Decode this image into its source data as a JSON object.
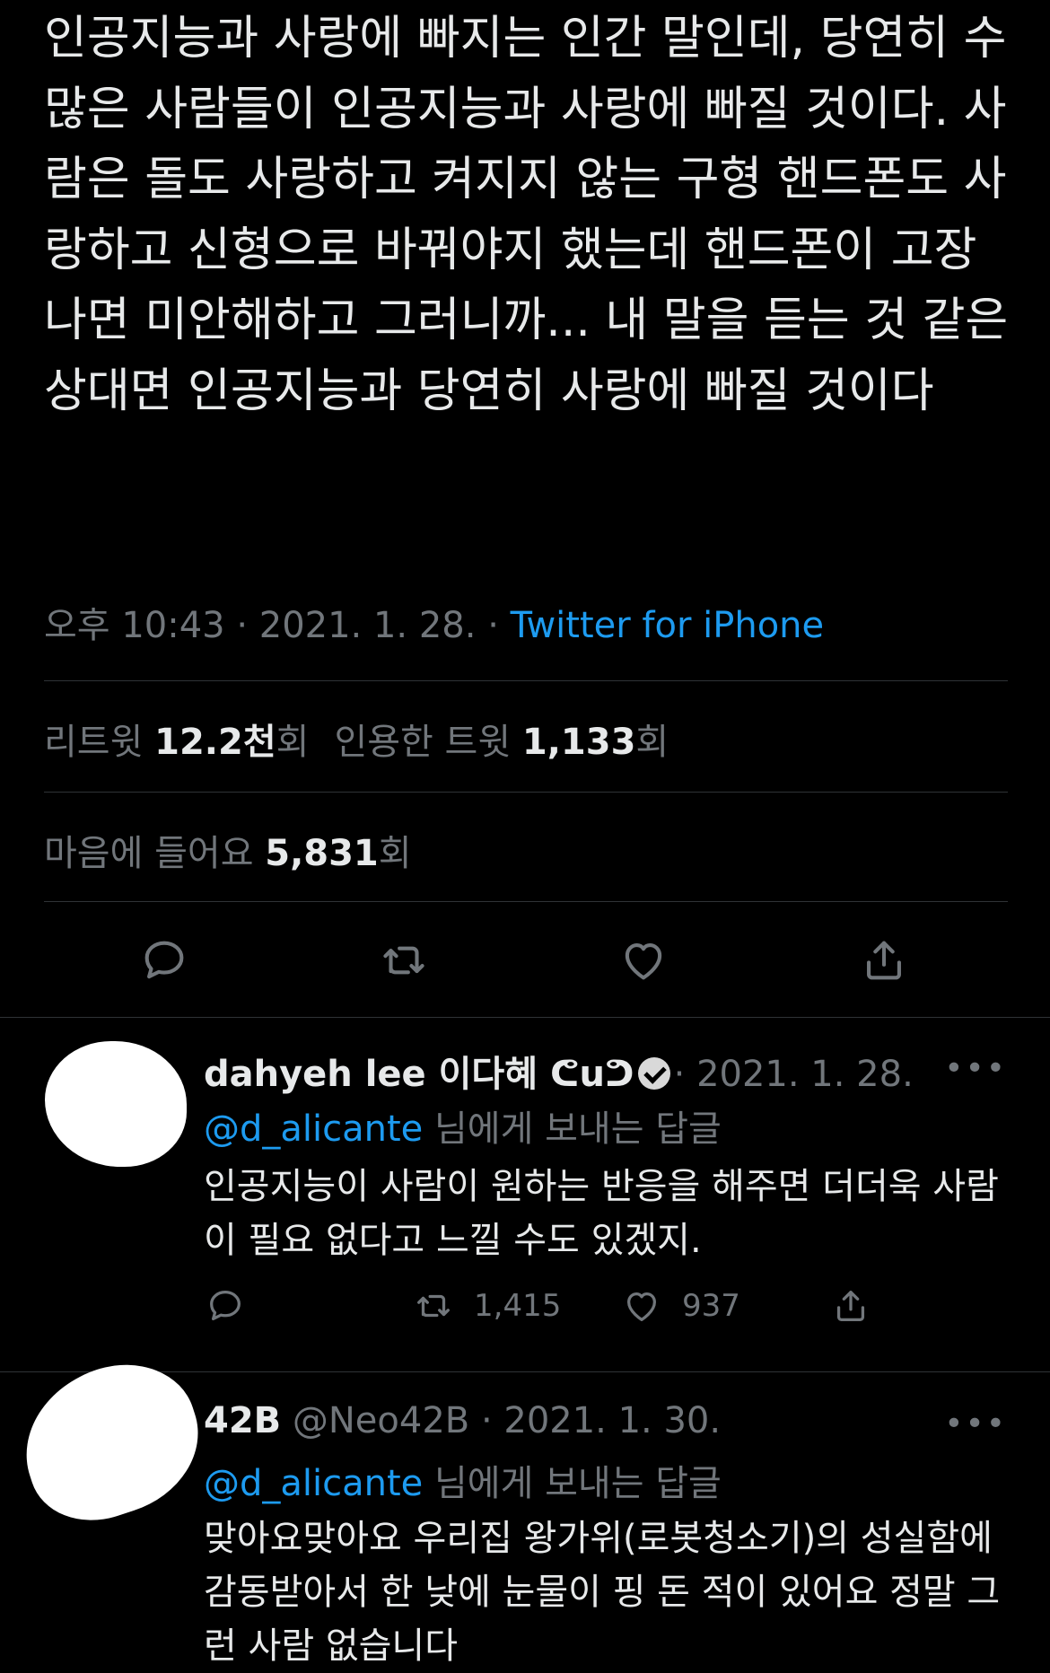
{
  "tweet": {
    "text": "인공지능과 사랑에 빠지는 인간 말인데, 당연히 수많은 사람들이 인공지능과 사랑에 빠질 것이다. 사람은 돌도 사랑하고 켜지지 않는 구형 핸드폰도 사랑하고 신형으로 바꿔야지 했는데 핸드폰이 고장나면 미안해하고 그러니까... 내 말을 듣는 것 같은 상대면 인공지능과 당연히 사랑에 빠질 것이다",
    "time": "오후 10:43",
    "date": "2021. 1. 28.",
    "source": "Twitter for iPhone",
    "separator": "·",
    "stats": {
      "retweets_label": "리트윗",
      "retweets_value": "12.2천",
      "retweets_unit": "회",
      "quotes_label": "인용한 트윗",
      "quotes_value": "1,133",
      "quotes_unit": "회",
      "likes_label": "마음에 들어요",
      "likes_value": "5,831",
      "likes_unit": "회"
    },
    "actions": [
      "reply-icon",
      "retweet-icon",
      "like-icon",
      "share-icon"
    ]
  },
  "replies": [
    {
      "name": "dahyeh lee 이다혜 ᕦuᕤ",
      "verified": true,
      "date": "· 2021. 1. 28.",
      "more": "•••",
      "mention": "@d_alicante",
      "reply_to_suffix": " 님에게 보내는 답글",
      "text": "인공지능이 사람이 원하는 반응을 해주면 더더욱 사람이 필요 없다고 느낄 수도 있겠지.",
      "retweets": "1,415",
      "likes": "937"
    },
    {
      "name": "42B",
      "handle": "@Neo42B",
      "date": "· 2021. 1. 30.",
      "more": "•••",
      "mention": "@d_alicante",
      "reply_to_suffix": " 님에게 보내는 답글",
      "text": "맞아요맞아요 우리집 왕가위(로봇청소기)의 성실함에 감동받아서 한 낮에 눈물이 핑 돈 적이 있어요 정말 그런 사람 없습니다"
    }
  ],
  "colors": {
    "background": "#000000",
    "text": "#e7e9ea",
    "muted": "#71767b",
    "accent": "#1d9bf0",
    "divider": "#2f3336"
  }
}
